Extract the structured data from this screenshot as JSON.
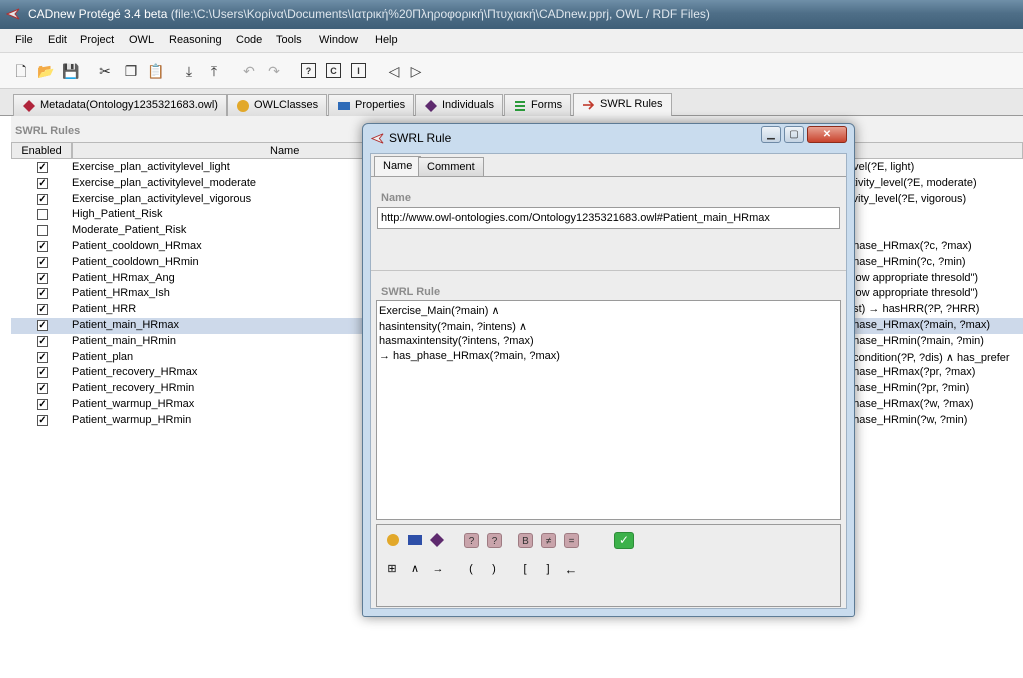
{
  "window": {
    "title": "CADnew  Protégé 3.4 beta",
    "path": "(file:\\C:\\Users\\Κορίνα\\Documents\\Ιατρική%20Πληροφορική\\Πτυχιακή\\CADnew.pprj, OWL / RDF Files)"
  },
  "menu": [
    "File",
    "Edit",
    "Project",
    "OWL",
    "Reasoning",
    "Code",
    "Tools",
    "Window",
    "Help"
  ],
  "tabs": [
    {
      "label": "Metadata(Ontology1235321683.owl)",
      "icon": "diamond-red-icon",
      "color": "#b0243b"
    },
    {
      "label": "OWLClasses",
      "icon": "circle-yellow-icon",
      "color": "#e2a82a"
    },
    {
      "label": "Properties",
      "icon": "rect-blue-icon",
      "color": "#2e6bb8"
    },
    {
      "label": "Individuals",
      "icon": "diamond-purple-icon",
      "color": "#5e2a6e"
    },
    {
      "label": "Forms",
      "icon": "forms-icon",
      "color": "#2a9a3a"
    },
    {
      "label": "SWRL Rules",
      "icon": "arrow-icon",
      "color": "#c0392b"
    }
  ],
  "panel": {
    "title": "SWRL Rules",
    "col_enabled": "Enabled",
    "col_name": "Name"
  },
  "rules": [
    {
      "enabled": true,
      "name": "Exercise_plan_activitylevel_light",
      "expr": "evel(?E, light)"
    },
    {
      "enabled": true,
      "name": "Exercise_plan_activitylevel_moderate",
      "expr": "ctivity_level(?E, moderate)"
    },
    {
      "enabled": true,
      "name": "Exercise_plan_activitylevel_vigorous",
      "expr": "tivity_level(?E, vigorous)"
    },
    {
      "enabled": false,
      "name": "High_Patient_Risk",
      "expr": ""
    },
    {
      "enabled": false,
      "name": "Moderate_Patient_Risk",
      "expr": ""
    },
    {
      "enabled": true,
      "name": "Patient_cooldown_HRmax",
      "expr": "phase_HRmax(?c, ?max)"
    },
    {
      "enabled": true,
      "name": "Patient_cooldown_HRmin",
      "expr": "phase_HRmin(?c, ?min)"
    },
    {
      "enabled": true,
      "name": "Patient_HRmax_Ang",
      "expr": "elow appropriate thresold\")"
    },
    {
      "enabled": true,
      "name": "Patient_HRmax_Ish",
      "expr": "elow appropriate thresold\")"
    },
    {
      "enabled": true,
      "name": "Patient_HRR",
      "expr": "est) → hasHRR(?P, ?HRR)"
    },
    {
      "enabled": true,
      "name": "Patient_main_HRmax",
      "expr": "phase_HRmax(?main, ?max)",
      "selected": true
    },
    {
      "enabled": true,
      "name": "Patient_main_HRmin",
      "expr": "phase_HRmin(?main, ?min)"
    },
    {
      "enabled": true,
      "name": "Patient_plan",
      "expr": "_condition(?P, ?dis) ∧ has_prefer"
    },
    {
      "enabled": true,
      "name": "Patient_recovery_HRmax",
      "expr": "phase_HRmax(?pr, ?max)"
    },
    {
      "enabled": true,
      "name": "Patient_recovery_HRmin",
      "expr": "phase_HRmin(?pr, ?min)"
    },
    {
      "enabled": true,
      "name": "Patient_warmup_HRmax",
      "expr": "phase_HRmax(?w, ?max)"
    },
    {
      "enabled": true,
      "name": "Patient_warmup_HRmin",
      "expr": "phase_HRmin(?w, ?min)"
    }
  ],
  "dialog": {
    "title": "SWRL Rule",
    "tab_name": "Name",
    "tab_comment": "Comment",
    "name_label": "Name",
    "name_value": "http://www.owl-ontologies.com/Ontology1235321683.owl#Patient_main_HRmax",
    "rule_label": "SWRL Rule",
    "rule_lines": [
      "Exercise_Main(?main)  ∧",
      "hasintensity(?main, ?intens)  ∧",
      "hasmaxintensity(?intens, ?max)",
      "  → has_phase_HRmax(?main, ?max)"
    ],
    "palette_row2": [
      "⊞",
      "∧",
      "→",
      "(",
      ")",
      "[",
      "]",
      "←"
    ],
    "palette_pink": [
      "?",
      "?",
      "B",
      "≠",
      "="
    ],
    "ok_icon": "✓"
  }
}
